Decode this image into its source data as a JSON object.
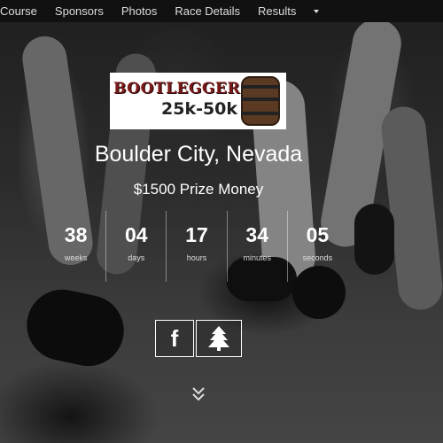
{
  "nav": {
    "items": [
      "Course",
      "Sponsors",
      "Photos",
      "Race Details",
      "Results"
    ]
  },
  "logo": {
    "icon": "bootlegger-logo",
    "word": "BOOTLEGGER",
    "distance": "25k-50k"
  },
  "hero": {
    "location": "Boulder City, Nevada",
    "prize": "$1500 Prize Money"
  },
  "countdown": [
    {
      "value": "38",
      "label": "weeks"
    },
    {
      "value": "04",
      "label": "days"
    },
    {
      "value": "17",
      "label": "hours"
    },
    {
      "value": "34",
      "label": "minutes"
    },
    {
      "value": "05",
      "label": "seconds"
    }
  ],
  "social": {
    "facebook_icon": "facebook-icon",
    "tree_icon": "pine-tree-icon"
  },
  "scroll_icon": "double-chevron-down-icon"
}
